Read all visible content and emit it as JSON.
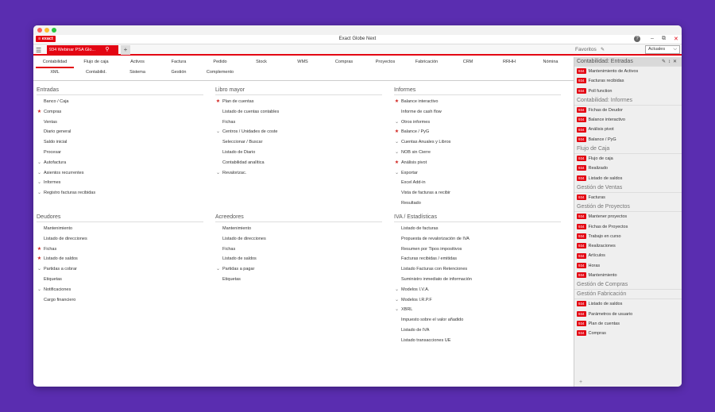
{
  "app": {
    "logo": "≡ exact",
    "title": "Exact Globe Next",
    "company_tab": "934 Webinar PSA Glo...",
    "help": "?",
    "min": "–",
    "restore": "⧉",
    "close": "✕"
  },
  "favorites": {
    "title": "Favoritos",
    "select_value": "Actuales",
    "groups": [
      {
        "title": "Contabilidad: Entradas",
        "items": [
          "Mantenimiento de Activos",
          "Facturas recibidas",
          "Poll function"
        ]
      },
      {
        "title": "Contabilidad: Informes",
        "items": [
          "Fichas de Deudor",
          "Balance interactivo",
          "Análisis pivot",
          "Balance / PyG"
        ]
      },
      {
        "title": "Flujo de Caja",
        "items": [
          "Flujo de caja",
          "Realizado",
          "Listado de saldos"
        ]
      },
      {
        "title": "Gestión de Ventas",
        "items": [
          "Facturas"
        ]
      },
      {
        "title": "Gestión de Proyectos",
        "items": [
          "Mantener proyectos",
          "Fichas de Proyectos",
          "Trabajo en curso",
          "Realizaciones",
          "Artículos",
          "Horas",
          "Mantenimiento"
        ]
      },
      {
        "title": "Gestión de Compras",
        "items": []
      },
      {
        "title": "Gestión Fabricación",
        "items": [
          "Listado de saldos",
          "Parámetros de usuario",
          "Plan de cuentas",
          "Compras"
        ]
      }
    ],
    "badge": "934",
    "add": "+"
  },
  "menu": {
    "row1": [
      "Contabilidad",
      "Flujo de caja",
      "Activos",
      "Factura",
      "Pedido",
      "Stock",
      "WMS",
      "Compras",
      "Proyectos",
      "Fabricación",
      "CRM",
      "RRHH",
      "Nómina"
    ],
    "row2": [
      "XML",
      "Contabilid.",
      "Sistema",
      "Gestión",
      "Complemento"
    ]
  },
  "sections": {
    "entradas": {
      "title": "Entradas",
      "items": [
        {
          "m": "",
          "t": "Banco / Caja"
        },
        {
          "m": "star",
          "t": "Compras"
        },
        {
          "m": "",
          "t": "Ventas"
        },
        {
          "m": "",
          "t": "Diario general"
        },
        {
          "m": "",
          "t": "Saldo inicial"
        },
        {
          "m": "",
          "t": "Procesar"
        },
        {
          "m": "chev",
          "t": "Autofactura"
        },
        {
          "m": "chev",
          "t": "Asientos recurrentes"
        },
        {
          "m": "chev",
          "t": "Informes"
        },
        {
          "m": "chev",
          "t": "Registro facturas recibidas"
        }
      ]
    },
    "libro": {
      "title": "Libro mayor",
      "items": [
        {
          "m": "star",
          "t": "Plan de cuentas"
        },
        {
          "m": "",
          "t": "Listado de cuentas contables"
        },
        {
          "m": "",
          "t": "Fichas"
        },
        {
          "m": "chev",
          "t": "Centros / Unidades de coste"
        },
        {
          "m": "",
          "t": "Seleccionar  / Buscar"
        },
        {
          "m": "",
          "t": "Listado de Diario"
        },
        {
          "m": "",
          "t": "Contabilidad analítica"
        },
        {
          "m": "chev",
          "t": "Revalorizac."
        }
      ]
    },
    "informes": {
      "title": "Informes",
      "items": [
        {
          "m": "star",
          "t": "Balance interactivo"
        },
        {
          "m": "",
          "t": "Informe de cash flow"
        },
        {
          "m": "chev",
          "t": "Otros informes"
        },
        {
          "m": "star",
          "t": "Balance / PyG"
        },
        {
          "m": "chev",
          "t": "Cuentas Anuales y Libros"
        },
        {
          "m": "chev",
          "t": "NOB sin Cierre"
        },
        {
          "m": "star",
          "t": "Análisis pivot"
        },
        {
          "m": "chev",
          "t": "Exportar"
        },
        {
          "m": "",
          "t": "Excel Add-in"
        },
        {
          "m": "",
          "t": "Vista de facturas a recibir"
        },
        {
          "m": "",
          "t": "Resultado"
        }
      ]
    },
    "deudores": {
      "title": "Deudores",
      "items": [
        {
          "m": "",
          "t": "Mantenimiento"
        },
        {
          "m": "",
          "t": "Listado de direcciones"
        },
        {
          "m": "star",
          "t": "Fichas"
        },
        {
          "m": "star",
          "t": "Listado de saldos"
        },
        {
          "m": "chev",
          "t": "Partidas a cobrar"
        },
        {
          "m": "",
          "t": "Etiquetas"
        },
        {
          "m": "chev",
          "t": "Notificaciones"
        },
        {
          "m": "",
          "t": "Cargo financiero"
        }
      ]
    },
    "acreedores": {
      "title": "Acreedores",
      "items": [
        {
          "m": "",
          "t": "Mantenimiento"
        },
        {
          "m": "",
          "t": "Listado de direcciones"
        },
        {
          "m": "",
          "t": "Fichas"
        },
        {
          "m": "",
          "t": "Listado de saldos"
        },
        {
          "m": "chev",
          "t": "Partidas a pagar"
        },
        {
          "m": "",
          "t": "Etiquetas"
        }
      ]
    },
    "iva": {
      "title": "IVA / Estadísticas",
      "items": [
        {
          "m": "",
          "t": "Listado de facturas"
        },
        {
          "m": "",
          "t": "Propuesta de revalorización de IVA"
        },
        {
          "m": "",
          "t": "Resumen por Tipos impositivos"
        },
        {
          "m": "",
          "t": "Facturas recibidas / emitidas"
        },
        {
          "m": "",
          "t": "Listado Facturas con Retenciones"
        },
        {
          "m": "",
          "t": "Suministro inmediato de información"
        },
        {
          "m": "chev",
          "t": "Modelos I.V.A."
        },
        {
          "m": "chev",
          "t": "Modelos I.R.P.F"
        },
        {
          "m": "chev",
          "t": "XBRL"
        },
        {
          "m": "",
          "t": "Impuesto sobre el valor añadido"
        },
        {
          "m": "",
          "t": "Listado de IVA"
        },
        {
          "m": "",
          "t": "Listado transacciones UE"
        }
      ]
    }
  },
  "colors": {
    "accent": "#e30613",
    "star": "#d0211c",
    "bg": "#5a2db0"
  },
  "icons": {
    "star": "★",
    "chev": "⌄",
    "search": "⚲",
    "hamburger": "☰",
    "pin": "✎"
  }
}
